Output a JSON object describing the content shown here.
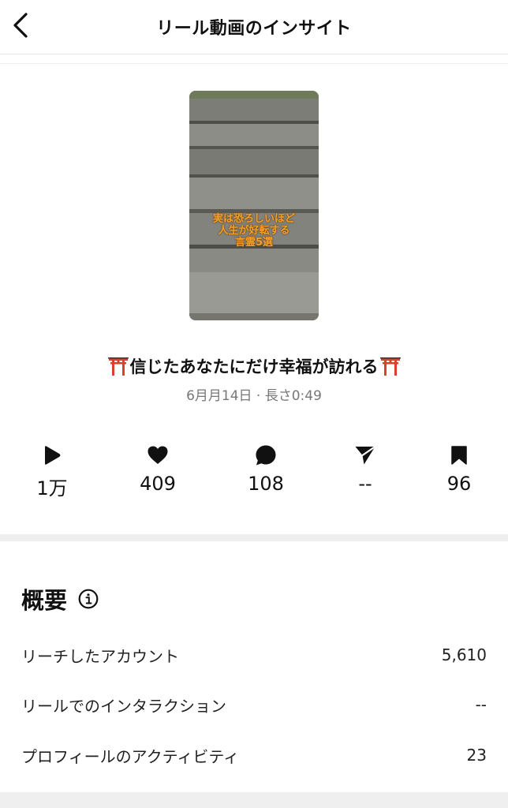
{
  "header": {
    "title": "リール動画のインサイト",
    "back_icon": "chevron-left-icon"
  },
  "thumbnail": {
    "caption": "実は恐ろしいほど\n人生が好転する\n言霊5選"
  },
  "video": {
    "title": "信じたあなたにだけ幸福が訪れる",
    "title_emoji": "torii-icon",
    "meta": "6月月14日 · 長さ0:49"
  },
  "stats": [
    {
      "icon": "play-icon",
      "value": "1万"
    },
    {
      "icon": "heart-icon",
      "value": "409"
    },
    {
      "icon": "comment-icon",
      "value": "108"
    },
    {
      "icon": "share-icon",
      "value": "--"
    },
    {
      "icon": "bookmark-icon",
      "value": "96"
    }
  ],
  "overview": {
    "title": "概要",
    "info_icon": "info-icon",
    "rows": [
      {
        "label": "リーチしたアカウント",
        "value": "5,610"
      },
      {
        "label": "リールでのインタラクション",
        "value": "--"
      },
      {
        "label": "プロフィールのアクティビティ",
        "value": "23"
      }
    ]
  }
}
